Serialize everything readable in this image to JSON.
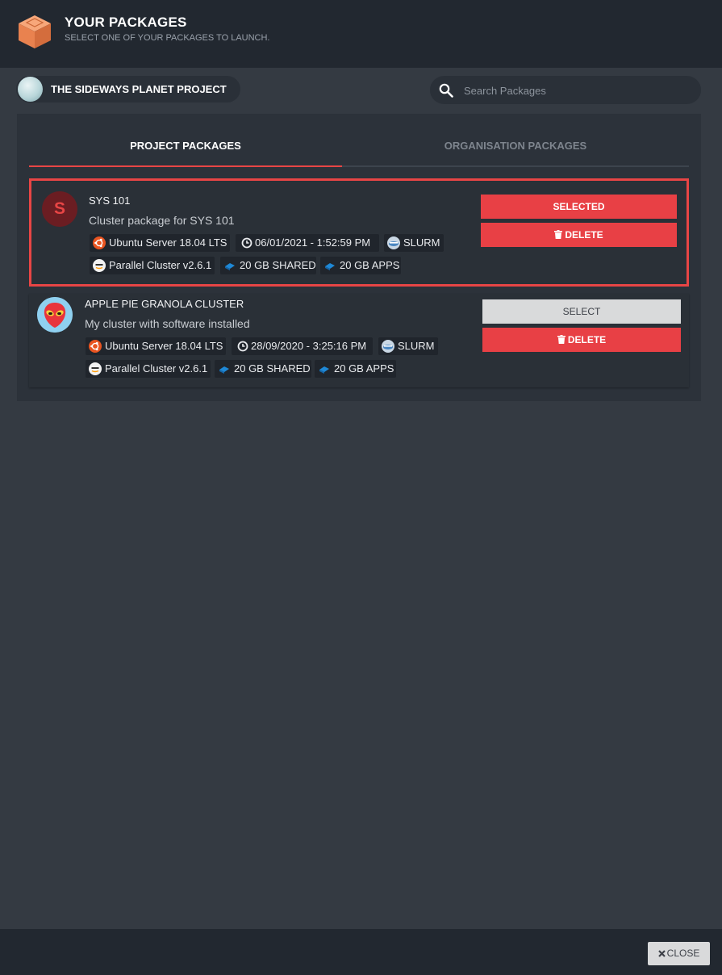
{
  "header": {
    "title": "YOUR PACKAGES",
    "subtitle": "SELECT ONE OF YOUR PACKAGES TO LAUNCH.",
    "logo_icon": "package-box-icon"
  },
  "project": {
    "name": "THE SIDEWAYS PLANET PROJECT",
    "icon": "planet-orb-icon"
  },
  "search": {
    "placeholder": "Search Packages",
    "value": ""
  },
  "tabs": [
    {
      "label": "PROJECT PACKAGES",
      "active": true
    },
    {
      "label": "ORGANISATION PACKAGES",
      "active": false
    }
  ],
  "packages": [
    {
      "avatar_letter": "S",
      "name": "SYS 101",
      "description": "Cluster package for SYS 101",
      "os": "Ubuntu Server 18.04 LTS",
      "date": "06/01/2021 - 1:52:59 PM",
      "scheduler": "SLURM",
      "cluster": "Parallel Cluster v2.6.1",
      "shared": "20 GB SHARED",
      "apps": "20 GB APPS",
      "primary_label": "SELECTED",
      "delete_label": "DELETE",
      "selected": true
    },
    {
      "avatar_icon": "alien-icon",
      "name": "APPLE PIE GRANOLA CLUSTER",
      "description": "My cluster with software installed",
      "os": "Ubuntu Server 18.04 LTS",
      "date": "28/09/2020 - 3:25:16 PM",
      "scheduler": "SLURM",
      "cluster": "Parallel Cluster v2.6.1",
      "shared": "20 GB SHARED",
      "apps": "20 GB APPS",
      "primary_label": "SELECT",
      "delete_label": "DELETE",
      "selected": false
    }
  ],
  "footer": {
    "close_label": "CLOSE"
  },
  "colors": {
    "accent": "#e84045",
    "background": "#343a42",
    "header": "#222830"
  }
}
